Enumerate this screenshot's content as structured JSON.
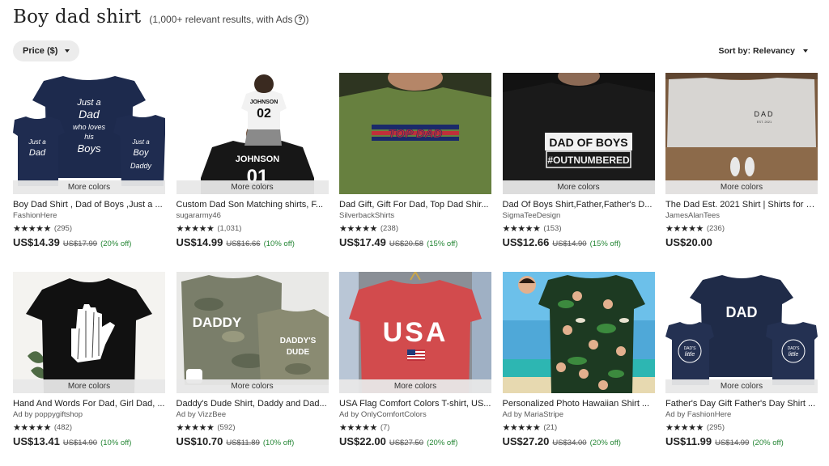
{
  "search": {
    "title": "Boy dad shirt",
    "results_text": "(1,000+ relevant results, with Ads",
    "results_close": ")",
    "help_icon": "?"
  },
  "filters": {
    "price_label": "Price ($)",
    "sort_label": "Sort by: Relevancy"
  },
  "colors": {
    "discount": "#258635",
    "pill_bg": "#ececec",
    "more_colors_bg": "#e8e8e8"
  },
  "products": [
    {
      "more_colors": "More colors",
      "title": "Boy Dad Shirt , Dad of Boys ,Just a ...",
      "shop": "FashionHere",
      "stars": "★★★★★",
      "reviews": "(295)",
      "price": "US$14.39",
      "original": "US$17.99",
      "discount": "(20% off)",
      "image": "navy-family-tees"
    },
    {
      "more_colors": "More colors",
      "title": "Custom Dad Son Matching shirts, F...",
      "shop": "sugararmy46",
      "stars": "★★★★★",
      "reviews": "(1,031)",
      "price": "US$14.99",
      "original": "US$16.66",
      "discount": "(10% off)",
      "image": "johnson-jerseys"
    },
    {
      "more_colors": "",
      "title": "Dad Gift, Gift For Dad, Top Dad Shir...",
      "shop": "SilverbackShirts",
      "stars": "★★★★★",
      "reviews": "(238)",
      "price": "US$17.49",
      "original": "US$20.58",
      "discount": "(15% off)",
      "image": "top-dad-green"
    },
    {
      "more_colors": "More colors",
      "title": "Dad Of Boys Shirt,Father,Father's D...",
      "shop": "SigmaTeeDesign",
      "stars": "★★★★★",
      "reviews": "(153)",
      "price": "US$12.66",
      "original": "US$14.90",
      "discount": "(15% off)",
      "image": "dad-of-boys-black"
    },
    {
      "more_colors": "More colors",
      "title": "The Dad Est. 2021 Shirt | Shirts for D...",
      "shop": "JamesAlanTees",
      "stars": "★★★★★",
      "reviews": "(236)",
      "price": "US$20.00",
      "original": "",
      "discount": "",
      "image": "dad-est-grey"
    },
    {
      "more_colors": "More colors",
      "title": "Hand And Words For Dad, Girl Dad, ...",
      "shop": "Ad by poppygiftshop",
      "stars": "★★★★★",
      "reviews": "(482)",
      "price": "US$13.41",
      "original": "US$14.90",
      "discount": "(10% off)",
      "image": "hand-black"
    },
    {
      "more_colors": "More colors",
      "title": "Daddy's Dude Shirt, Daddy and Dad...",
      "shop": "Ad by VizzBee",
      "stars": "★★★★★",
      "reviews": "(592)",
      "price": "US$10.70",
      "original": "US$11.89",
      "discount": "(10% off)",
      "image": "camo-daddy"
    },
    {
      "more_colors": "More colors",
      "title": "USA Flag Comfort Colors T-shirt, US...",
      "shop": "Ad by OnlyComfortColors",
      "stars": "★★★★★",
      "reviews": "(7)",
      "price": "US$22.00",
      "original": "US$27.50",
      "discount": "(20% off)",
      "image": "usa-red"
    },
    {
      "more_colors": "",
      "title": "Personalized Photo Hawaiian Shirt ...",
      "shop": "Ad by MariaStripe",
      "stars": "★★★★★",
      "reviews": "(21)",
      "price": "US$27.20",
      "original": "US$34.00",
      "discount": "(20% off)",
      "image": "hawaiian-photo"
    },
    {
      "more_colors": "More colors",
      "title": "Father's Day Gift Father's Day Shirt ...",
      "shop": "Ad by FashionHere",
      "stars": "★★★★★",
      "reviews": "(295)",
      "price": "US$11.99",
      "original": "US$14.99",
      "discount": "(20% off)",
      "image": "dad-little-man"
    }
  ]
}
